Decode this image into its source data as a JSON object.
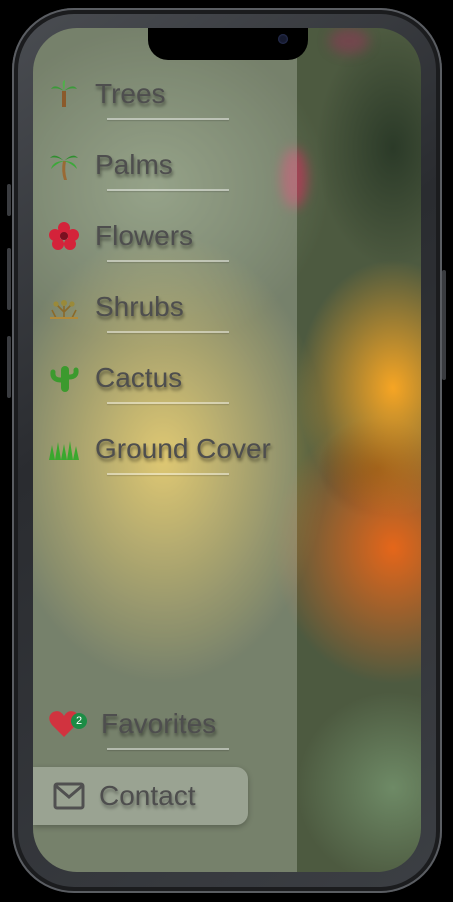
{
  "menu": {
    "items": [
      {
        "label": "Trees",
        "icon": "palm-tree-icon"
      },
      {
        "label": "Palms",
        "icon": "palm-icon"
      },
      {
        "label": "Flowers",
        "icon": "flower-icon"
      },
      {
        "label": "Shrubs",
        "icon": "shrub-icon"
      },
      {
        "label": "Cactus",
        "icon": "cactus-icon"
      },
      {
        "label": "Ground Cover",
        "icon": "grass-icon"
      }
    ]
  },
  "favorites": {
    "label": "Favorites",
    "count": "2",
    "icon": "heart-icon"
  },
  "contact": {
    "label": "Contact",
    "icon": "mail-icon"
  },
  "colors": {
    "badge": "#1c8c45",
    "heart": "#d1333f",
    "text": "#4e4e4e"
  }
}
